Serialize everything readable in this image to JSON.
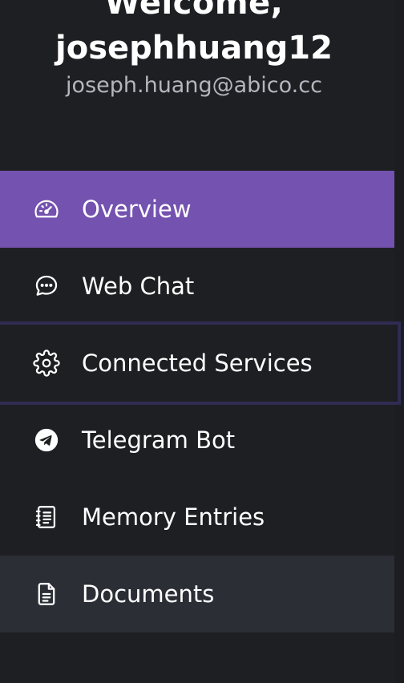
{
  "header": {
    "welcome": "Welcome,",
    "username": "josephhuang12",
    "email": "joseph.huang@abico.cc"
  },
  "nav": {
    "items": [
      {
        "label": "Overview",
        "icon": "dashboard-gauge-icon",
        "state": "active"
      },
      {
        "label": "Web Chat",
        "icon": "chat-bubble-icon",
        "state": "normal"
      },
      {
        "label": "Connected Services",
        "icon": "gear-icon",
        "state": "focused"
      },
      {
        "label": "Telegram Bot",
        "icon": "telegram-icon",
        "state": "normal"
      },
      {
        "label": "Memory Entries",
        "icon": "notebook-icon",
        "state": "normal"
      },
      {
        "label": "Documents",
        "icon": "document-icon",
        "state": "hover"
      }
    ]
  },
  "colors": {
    "background": "#1e1f23",
    "active": "#7452b0",
    "hover": "#2b2e35",
    "focus_border": "#2f2c53",
    "email_text": "#b3b6bd"
  }
}
